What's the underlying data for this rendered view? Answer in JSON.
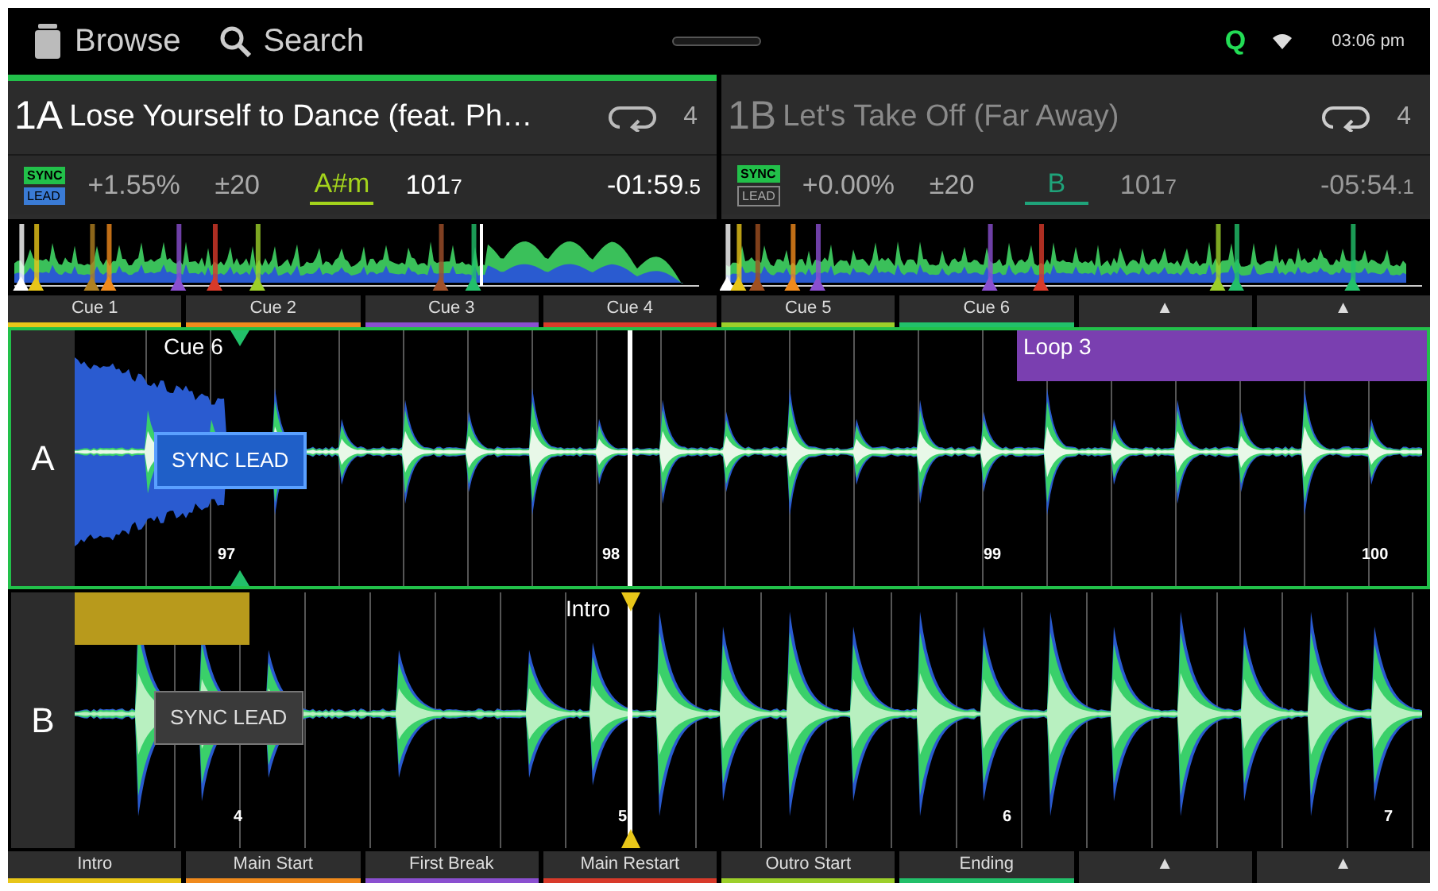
{
  "top_bar": {
    "browse": "Browse",
    "search": "Search",
    "quantize": "Q",
    "time": "03:06 pm"
  },
  "decks": [
    {
      "deck": "1A",
      "title": "Lose Yourself to Dance (feat. Ph…",
      "loop_count": "4",
      "active": true,
      "sync": "SYNC",
      "lead": "LEAD",
      "lead_on": true,
      "pitch": "+1.55%",
      "range": "±20",
      "key": {
        "text": "A#m",
        "color": "#a4d41c"
      },
      "bpm": "101",
      "bpm_decimal": "7",
      "time": "-01:59",
      "time_decimal": ".5"
    },
    {
      "deck": "1B",
      "title": "Let's Take Off (Far Away)",
      "loop_count": "4",
      "active": false,
      "sync": "SYNC",
      "lead": "LEAD",
      "lead_on": false,
      "pitch": "+0.00%",
      "range": "±20",
      "key": {
        "text": "B",
        "color": "#1fa37a"
      },
      "bpm": "101",
      "bpm_decimal": "7",
      "time": "-05:54",
      "time_decimal": ".1"
    }
  ],
  "cue_pads": [
    {
      "label": "Cue 1",
      "color": "#e8c619"
    },
    {
      "label": "Cue 2",
      "color": "#f08a1c"
    },
    {
      "label": "Cue 3",
      "color": "#8a4fd0"
    },
    {
      "label": "Cue 4",
      "color": "#d83a2a"
    },
    {
      "label": "Cue 5",
      "color": "#9ccf2a"
    },
    {
      "label": "Cue 6",
      "color": "#22c06a"
    },
    {
      "label": "▲"
    },
    {
      "label": "▲"
    }
  ],
  "waveforms": [
    {
      "label": "A",
      "selected": true,
      "sync_lead": "SYNC LEAD",
      "sync_lead_on": true,
      "cue_label": "Cue 6",
      "loop_label": "Loop 3",
      "beats": [
        "97",
        "98",
        "99",
        "100"
      ]
    },
    {
      "label": "B",
      "selected": false,
      "sync_lead": "SYNC LEAD",
      "sync_lead_on": false,
      "cue_label": "Intro",
      "beats": [
        "4",
        "5",
        "6",
        "7"
      ]
    }
  ],
  "section_pads": [
    {
      "label": "Intro",
      "color": "#e8c619"
    },
    {
      "label": "Main Start",
      "color": "#f08a1c"
    },
    {
      "label": "First Break",
      "color": "#8a4fd0"
    },
    {
      "label": "Main Restart",
      "color": "#d83a2a"
    },
    {
      "label": "Outro Start",
      "color": "#9ccf2a"
    },
    {
      "label": "Ending",
      "color": "#22c06a"
    },
    {
      "label": "▲"
    },
    {
      "label": "▲"
    }
  ]
}
